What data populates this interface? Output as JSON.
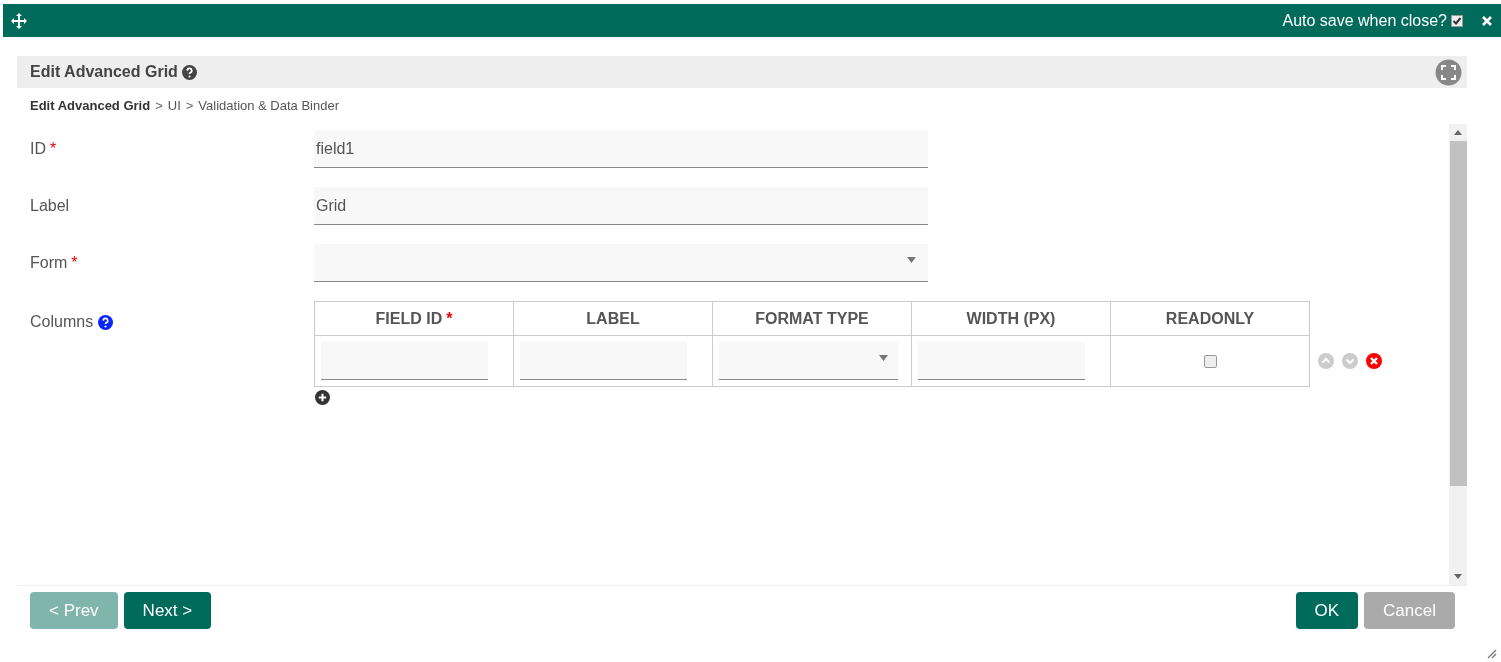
{
  "top_bar": {
    "autosave_label": "Auto save when close?",
    "autosave_checked": true
  },
  "header": {
    "title": "Edit Advanced Grid"
  },
  "breadcrumb": [
    {
      "text": "Edit Advanced Grid",
      "current": true
    },
    {
      "text": "UI",
      "current": false
    },
    {
      "text": "Validation & Data Binder",
      "current": false
    }
  ],
  "separator": ">",
  "required_mark": "*",
  "fields": [
    {
      "kind": "text",
      "label": "ID",
      "required": true,
      "value": "field1"
    },
    {
      "kind": "text",
      "label": "Label",
      "required": false,
      "value": "Grid"
    },
    {
      "kind": "select",
      "label": "Form",
      "required": true
    },
    {
      "kind": "grid",
      "label": "Columns",
      "required": false,
      "help": true,
      "columns": [
        {
          "title": "FIELD ID",
          "required": true,
          "kind": "text"
        },
        {
          "title": "LABEL",
          "required": false,
          "kind": "text"
        },
        {
          "title": "FORMAT TYPE",
          "required": false,
          "kind": "select"
        },
        {
          "title": "WIDTH (PX)",
          "required": false,
          "kind": "text"
        },
        {
          "title": "READONLY",
          "required": false,
          "kind": "checkbox",
          "checked": false
        }
      ]
    }
  ],
  "nav_buttons": [
    {
      "label": "< Prev",
      "disabled": true
    },
    {
      "label": "Next >",
      "disabled": false
    }
  ],
  "action_buttons": [
    {
      "label": "OK",
      "kind": "primary"
    },
    {
      "label": "Cancel",
      "kind": "secondary"
    }
  ]
}
